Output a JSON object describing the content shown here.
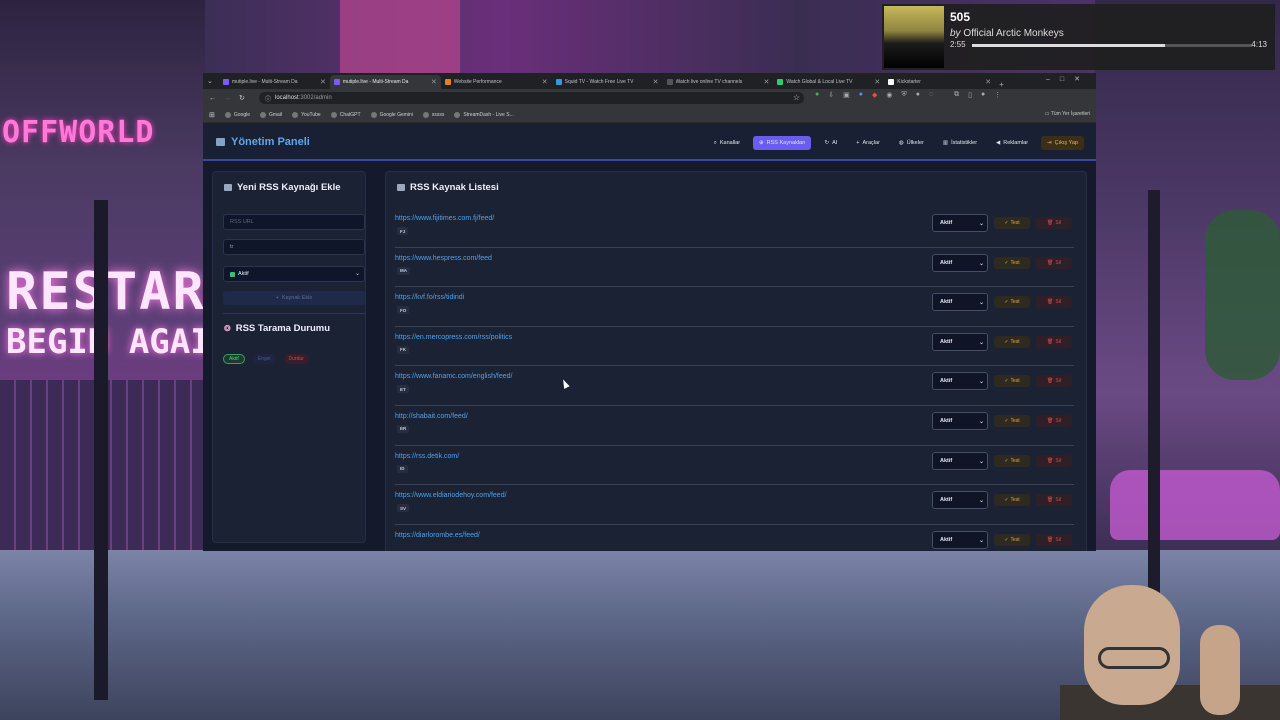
{
  "background": {
    "sign_offworld": "OFFWORLD",
    "sign_restart": "RESTAR",
    "sign_begin": "BEGIN AGAI"
  },
  "music": {
    "song": "505",
    "artist_prefix": "by",
    "artist": "Official Arctic Monkeys",
    "elapsed": "2:55",
    "duration": "4:13",
    "progress": 0.69
  },
  "browser": {
    "tabs": [
      {
        "label": "mutiple.live - Multi-Stream Da",
        "color": "#7a5cf0"
      },
      {
        "label": "mutiple.live - Multi-Stream Da",
        "color": "#7a5cf0",
        "active": true
      },
      {
        "label": "Website Performance",
        "color": "#e67e22"
      },
      {
        "label": "Squid TV - Watch Free Live TV",
        "color": "#3498db"
      },
      {
        "label": "Watch live online TV channels",
        "color": "#555555"
      },
      {
        "label": "Watch Global & Local Live TV",
        "color": "#2ecc71"
      },
      {
        "label": "Kickstarter",
        "color": "#ffffff"
      }
    ],
    "url_host": "localhost",
    "url_path": ":3002/admin",
    "bookmarks": [
      "Google",
      "Gmail",
      "YouTube",
      "ChatGPT",
      "Google Gemini",
      "sssss",
      "StreamDash - Live S..."
    ],
    "all_bookmarks": "Tüm Yer İşaretleri"
  },
  "app": {
    "brand": "Yönetim Paneli",
    "nav": [
      {
        "label": "Kanallar",
        "icon": "search-icon"
      },
      {
        "label": "RSS Kaynakları",
        "icon": "rss-icon",
        "active": true
      },
      {
        "label": "AI",
        "icon": "refresh-icon"
      },
      {
        "label": "Araçlar",
        "icon": "plus-icon"
      },
      {
        "label": "Ülkeler",
        "icon": "globe-icon"
      },
      {
        "label": "İstatistikler",
        "icon": "chart-icon"
      },
      {
        "label": "Reklamlar",
        "icon": "megaphone-icon"
      },
      {
        "label": "Çıkış Yap",
        "icon": "logout-icon"
      }
    ],
    "add_panel": {
      "title": "Yeni RSS Kaynağı Ekle",
      "url_placeholder": "RSS URL",
      "country_value": "tr",
      "status_value": "Aktif",
      "add_button": "Kaynak Ekle"
    },
    "scan_panel": {
      "title": "RSS Tarama Durumu",
      "pills": [
        "Aktif",
        "Engel",
        "Durdur"
      ]
    },
    "list_panel": {
      "title": "RSS Kaynak Listesi",
      "status_label": "Aktif",
      "test_label": "Test",
      "delete_label": "Sil",
      "feeds": [
        {
          "url": "https://www.fijitimes.com.fj/feed/",
          "code": "FJ"
        },
        {
          "url": "https://www.hespress.com/feed",
          "code": "MA"
        },
        {
          "url": "https://kvf.fo/rss/tidindi",
          "code": "FO"
        },
        {
          "url": "https://en.mercopress.com/rss/politics",
          "code": "FK"
        },
        {
          "url": "https://www.fanamc.com/english/feed/",
          "code": "ET"
        },
        {
          "url": "http://shabait.com/feed/",
          "code": "ER"
        },
        {
          "url": "https://rss.detik.com/",
          "code": "ID"
        },
        {
          "url": "https://www.eldiariodehoy.com/feed/",
          "code": "SV"
        },
        {
          "url": "https://diarlorombe.es/feed/",
          "code": ""
        }
      ]
    }
  }
}
